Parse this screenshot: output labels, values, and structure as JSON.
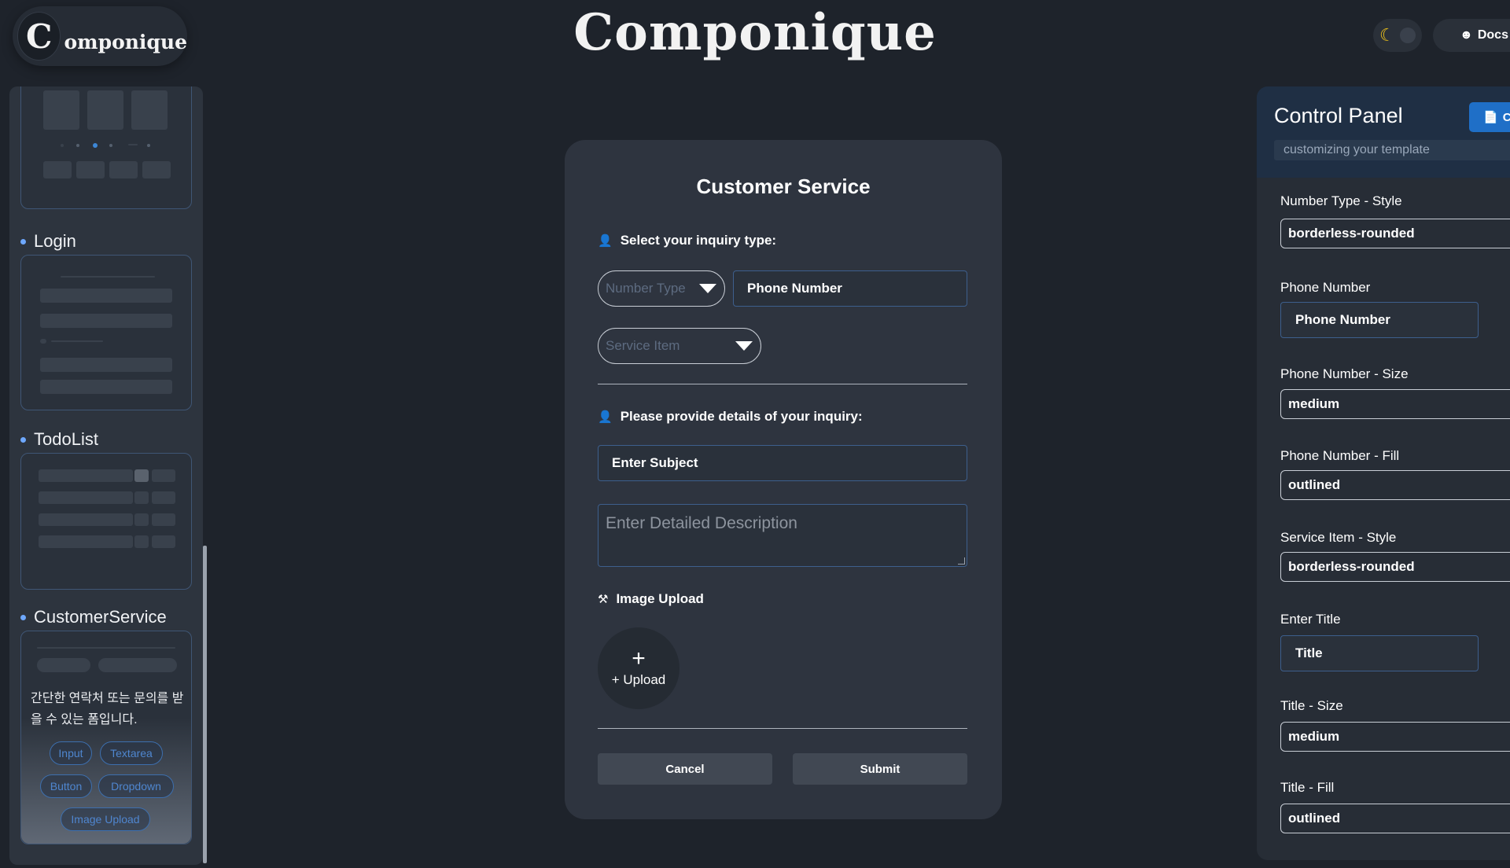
{
  "header": {
    "logo_letter": "C",
    "logo_text": "omponique",
    "title": "Componique",
    "docs_label": "Docs"
  },
  "sidebar": {
    "items": [
      {
        "label": "Login"
      },
      {
        "label": "TodoList"
      },
      {
        "label": "CustomerService",
        "description": "간단한 연락처 또는 문의를 받을 수 있는 폼입니다.",
        "tags": [
          "Input",
          "Textarea",
          "Button",
          "Dropdown",
          "Image Upload"
        ]
      }
    ]
  },
  "form": {
    "title": "Customer Service",
    "inquiry_type_label": "Select your inquiry type:",
    "number_type_placeholder": "Number Type",
    "phone_placeholder": "Phone Number",
    "service_item_placeholder": "Service Item",
    "details_label": "Please provide details of your inquiry:",
    "subject_placeholder": "Enter Subject",
    "description_placeholder": "Enter Detailed Description",
    "image_upload_label": "Image Upload",
    "upload_plus": "+",
    "upload_text": "+ Upload",
    "cancel_label": "Cancel",
    "submit_label": "Submit"
  },
  "panel": {
    "title": "Control Panel",
    "subtitle": "customizing your template",
    "button_label": "C",
    "fields": [
      {
        "label": "Number Type - Style",
        "value": "borderless-rounded"
      },
      {
        "label": "Phone Number",
        "value": "Phone Number"
      },
      {
        "label": "Phone Number - Size",
        "value": "medium"
      },
      {
        "label": "Phone Number - Fill",
        "value": "outlined"
      },
      {
        "label": "Service Item - Style",
        "value": "borderless-rounded"
      },
      {
        "label": "Enter Title",
        "value": "Title"
      },
      {
        "label": "Title - Size",
        "value": "medium"
      },
      {
        "label": "Title - Fill",
        "value": "outlined"
      }
    ]
  },
  "colors": {
    "background": "#1e232b",
    "card": "#2e343f",
    "accent": "#1f6fc7",
    "field_border": "#3d5f8d"
  }
}
